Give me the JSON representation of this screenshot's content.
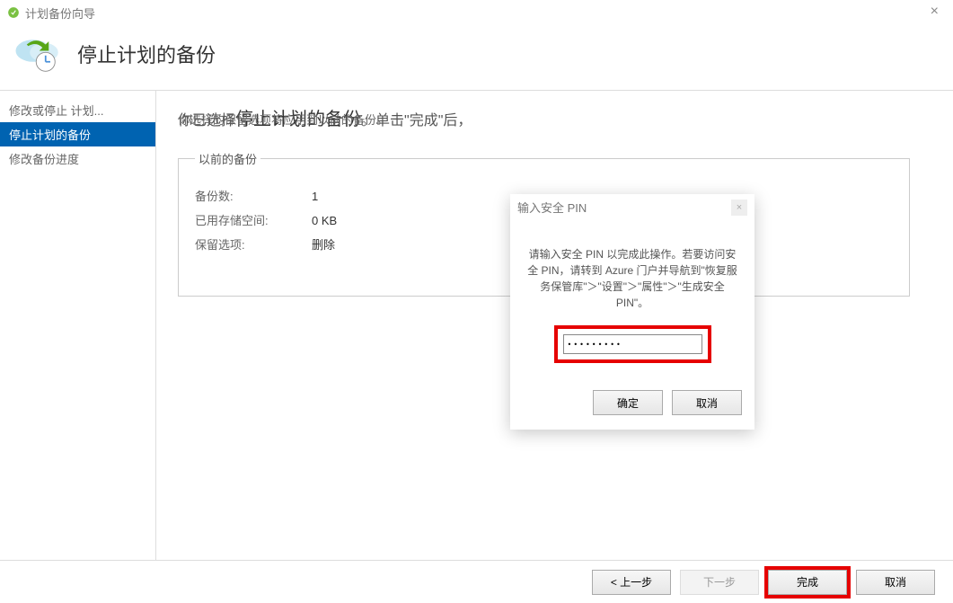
{
  "window": {
    "title": "计划备份向导",
    "close": "×"
  },
  "header": {
    "title": "停止计划的备份"
  },
  "sidebar": {
    "items": [
      {
        "label": "修改或停止 计划..."
      },
      {
        "label": "停止计划的备份"
      },
      {
        "label": "修改备份进度"
      }
    ],
    "activeIndex": 1
  },
  "main": {
    "line1_a": "你已选择",
    "line1_b": "停止计划的备份",
    "line1_c": "。单击\"完成\"后，",
    "line2": "你选择的保留选项将应用到以前的备份。"
  },
  "group": {
    "legend": "以前的备份",
    "rows": [
      {
        "label": "备份数:",
        "value": "1"
      },
      {
        "label": "已用存储空间:",
        "value": "0 KB"
      },
      {
        "label": "保留选项:",
        "value": "删除"
      }
    ]
  },
  "pin": {
    "placeholder": "输入安全 PIN",
    "body": "请输入安全 PIN 以完成此操作。若要访问安全 PIN，请转到 Azure 门户并导航到\"恢复服务保管库\"＞\"设置\"＞\"属性\"＞\"生成安全 PIN\"。",
    "value": "•••••••••",
    "ok": "确定",
    "cancel": "取消"
  },
  "footer": {
    "prev": "< 上一步",
    "next": "下一步",
    "finish": "完成",
    "cancel": "取消"
  }
}
